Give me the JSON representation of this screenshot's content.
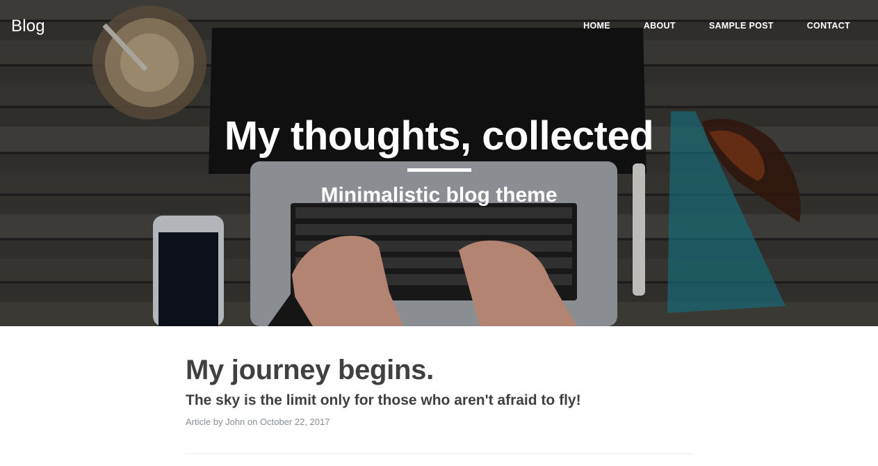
{
  "nav": {
    "brand": "Blog",
    "links": [
      "HOME",
      "ABOUT",
      "SAMPLE POST",
      "CONTACT"
    ]
  },
  "hero": {
    "title": "My thoughts, collected",
    "subtitle": "Minimalistic blog theme"
  },
  "post": {
    "title": "My journey begins.",
    "subtitle": "The sky is the limit only for those who aren't afraid to fly!",
    "meta_prefix": "Article by",
    "author": "John",
    "meta_on": "on",
    "date": "October 22, 2017"
  },
  "colors": {
    "text": "#404040",
    "meta": "#868e96",
    "white": "#ffffff"
  }
}
